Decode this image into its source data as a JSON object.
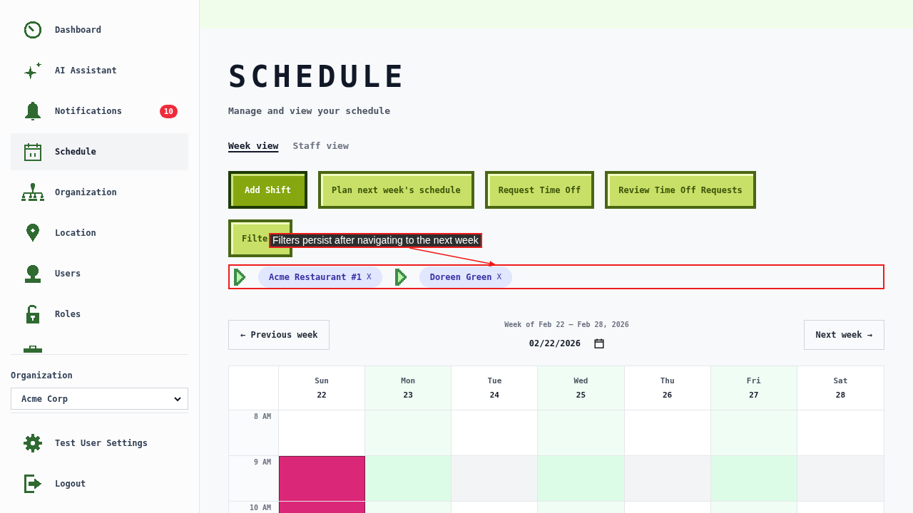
{
  "sidebar": {
    "items": [
      {
        "label": "Dashboard",
        "selected": false
      },
      {
        "label": "AI Assistant",
        "selected": false
      },
      {
        "label": "Notifications",
        "selected": false,
        "badge": "10"
      },
      {
        "label": "Schedule",
        "selected": true
      },
      {
        "label": "Organization",
        "selected": false
      },
      {
        "label": "Location",
        "selected": false
      },
      {
        "label": "Users",
        "selected": false
      },
      {
        "label": "Roles",
        "selected": false
      }
    ],
    "organization": {
      "label": "Organization",
      "value": "Acme Corp"
    },
    "footer_items": [
      {
        "label": "Test User Settings"
      },
      {
        "label": "Logout"
      }
    ]
  },
  "header": {
    "title": "SCHEDULE",
    "subtitle": "Manage and view your schedule"
  },
  "view_tabs": [
    {
      "label": "Week view",
      "selected": true
    },
    {
      "label": "Staff view",
      "selected": false
    }
  ],
  "actions": [
    {
      "label": "Add Shift",
      "kind": "primary"
    },
    {
      "label": "Plan next week's schedule",
      "kind": "secondary"
    },
    {
      "label": "Request Time Off",
      "kind": "secondary"
    },
    {
      "label": "Review Time Off Requests",
      "kind": "secondary"
    }
  ],
  "filter_button": {
    "label": "Filte"
  },
  "annotation": {
    "text": "Filters persist after navigating to the next week"
  },
  "filter_chips": {
    "outlined": true,
    "items": [
      {
        "label": "Acme Restaurant #1",
        "remove": "X"
      },
      {
        "label": "Doreen Green",
        "remove": "X"
      }
    ]
  },
  "week_nav": {
    "previous": "← Previous week",
    "range": "Week of Feb 22 – Feb 28, 2026",
    "date": "02/22/2026",
    "next": "Next week →"
  },
  "calendar": {
    "days": [
      {
        "name": "Sun",
        "date": "22",
        "highlighted": false
      },
      {
        "name": "Mon",
        "date": "23",
        "highlighted": true
      },
      {
        "name": "Tue",
        "date": "24",
        "highlighted": false
      },
      {
        "name": "Wed",
        "date": "25",
        "highlighted": true
      },
      {
        "name": "Thu",
        "date": "26",
        "highlighted": false
      },
      {
        "name": "Fri",
        "date": "27",
        "highlighted": true
      },
      {
        "name": "Sat",
        "date": "28",
        "highlighted": false
      }
    ],
    "hours": [
      {
        "label": "8 AM",
        "shaded": false,
        "cells": [
          {
            "kind": "empty"
          },
          {
            "kind": "empty"
          },
          {
            "kind": "empty"
          },
          {
            "kind": "empty"
          },
          {
            "kind": "empty"
          },
          {
            "kind": "empty"
          },
          {
            "kind": "empty"
          }
        ]
      },
      {
        "label": "9 AM",
        "shaded": true,
        "cells": [
          {
            "kind": "shift",
            "color": "#db2777"
          },
          {
            "kind": "empty"
          },
          {
            "kind": "empty"
          },
          {
            "kind": "empty"
          },
          {
            "kind": "empty"
          },
          {
            "kind": "empty"
          },
          {
            "kind": "empty"
          }
        ]
      },
      {
        "label": "10 AM",
        "shaded": false,
        "cells": [
          {
            "kind": "shift",
            "color": "#db2777"
          },
          {
            "kind": "empty"
          },
          {
            "kind": "empty"
          },
          {
            "kind": "empty"
          },
          {
            "kind": "empty"
          },
          {
            "kind": "empty"
          },
          {
            "kind": "empty"
          }
        ]
      }
    ]
  }
}
